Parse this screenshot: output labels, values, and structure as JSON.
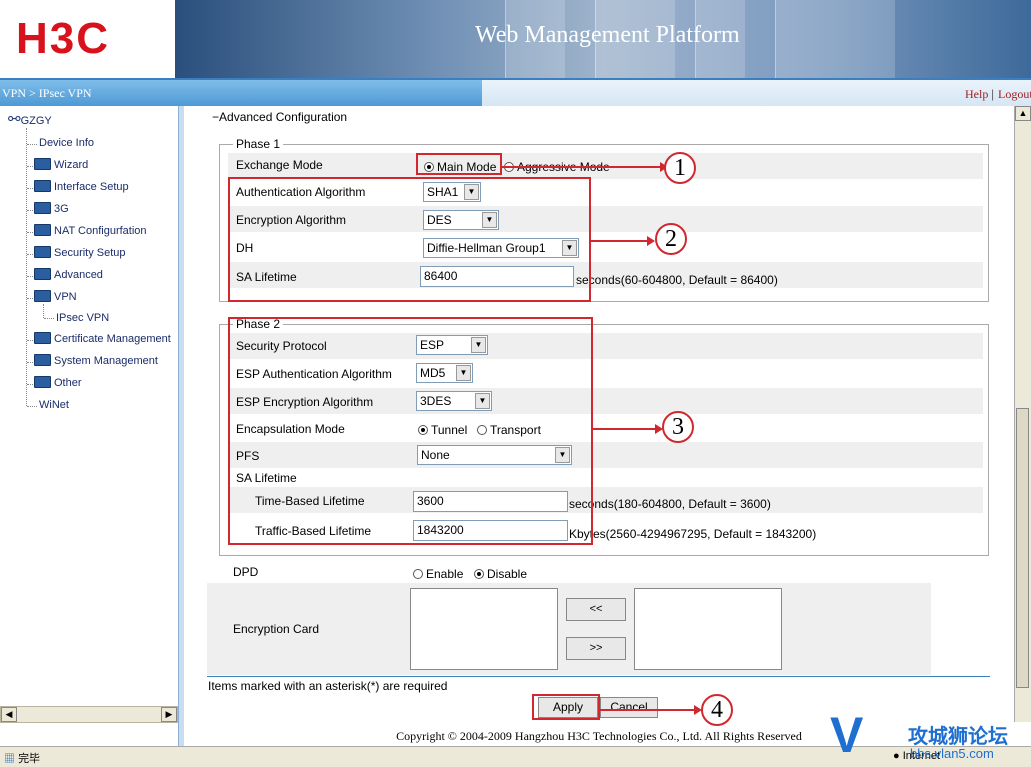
{
  "header": {
    "logo": "H3C",
    "title": "Web Management Platform"
  },
  "nav": {
    "breadcrumb": "VPN > IPsec VPN",
    "help": "Help",
    "logout": "Logout"
  },
  "sidebar": {
    "root": "GZGY",
    "items": [
      {
        "label": "Device Info",
        "folder": false
      },
      {
        "label": "Wizard",
        "folder": true
      },
      {
        "label": "Interface Setup",
        "folder": true
      },
      {
        "label": "3G",
        "folder": true
      },
      {
        "label": "NAT Configurfation",
        "folder": true
      },
      {
        "label": "Security Setup",
        "folder": true
      },
      {
        "label": "Advanced",
        "folder": true
      },
      {
        "label": "VPN",
        "folder": true
      },
      {
        "label": "IPsec VPN",
        "folder": false
      },
      {
        "label": "Certificate Management",
        "folder": true
      },
      {
        "label": "System Management",
        "folder": true
      },
      {
        "label": "Other",
        "folder": true
      },
      {
        "label": "WiNet",
        "folder": false
      }
    ]
  },
  "section": {
    "title": "Advanced Configuration",
    "toggle": "−"
  },
  "phase1": {
    "legend": "Phase 1",
    "exchange_mode_label": "Exchange Mode",
    "main_mode": "Main Mode",
    "aggressive_mode": "Aggressive Mode",
    "auth_label": "Authentication Algorithm",
    "auth_value": "SHA1",
    "enc_label": "Encryption Algorithm",
    "enc_value": "DES",
    "dh_label": "DH",
    "dh_value": "Diffie-Hellman Group1",
    "sa_label": "SA Lifetime",
    "sa_value": "86400",
    "sa_hint": "seconds(60-604800, Default = 86400)"
  },
  "phase2": {
    "legend": "Phase 2",
    "proto_label": "Security Protocol",
    "proto_value": "ESP",
    "esp_auth_label": "ESP Authentication Algorithm",
    "esp_auth_value": "MD5",
    "esp_enc_label": "ESP Encryption Algorithm",
    "esp_enc_value": "3DES",
    "encap_label": "Encapsulation Mode",
    "tunnel": "Tunnel",
    "transport": "Transport",
    "pfs_label": "PFS",
    "pfs_value": "None",
    "sa_label": "SA Lifetime",
    "time_label": "Time-Based Lifetime",
    "time_value": "3600",
    "time_hint": "seconds(180-604800, Default = 3600)",
    "traffic_label": "Traffic-Based Lifetime",
    "traffic_value": "1843200",
    "traffic_hint": "Kbytes(2560-4294967295, Default = 1843200)"
  },
  "dpd": {
    "label": "DPD",
    "enable": "Enable",
    "disable": "Disable"
  },
  "enc_card": {
    "label": "Encryption Card",
    "add": "<<",
    "remove": ">>"
  },
  "note": "Items marked with an asterisk(*) are required",
  "buttons": {
    "apply": "Apply",
    "cancel": "Cancel"
  },
  "callouts": [
    "1",
    "2",
    "3",
    "4"
  ],
  "copyright": "Copyright © 2004-2009 Hangzhou H3C Technologies Co., Ltd. All Rights Reserved",
  "status": {
    "done": "完毕",
    "zone": "Internet"
  },
  "watermark": {
    "text": "攻城狮论坛",
    "url": "bbs.vlan5.com"
  },
  "colors": {
    "brand": "#d7121c",
    "annotation": "#d0282e",
    "nav": "#4e9ad5"
  }
}
